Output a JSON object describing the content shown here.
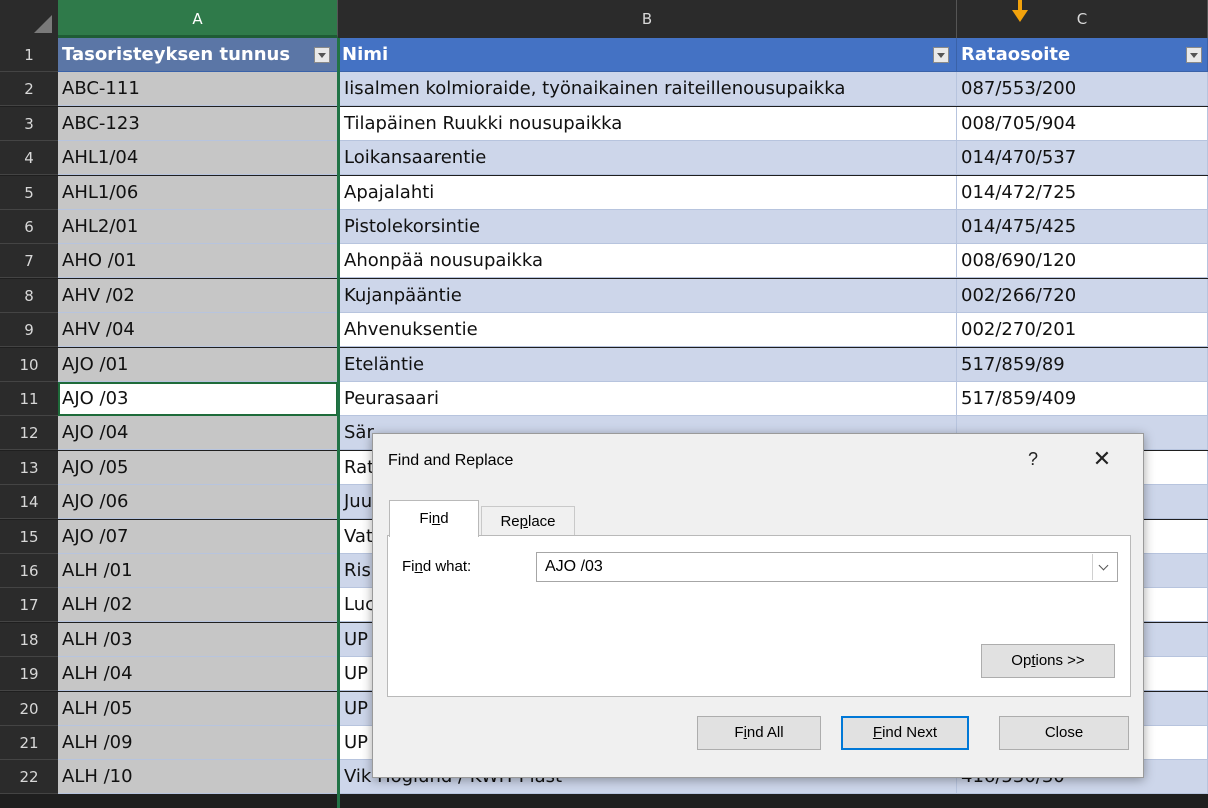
{
  "columns": [
    "A",
    "B",
    "C"
  ],
  "header_row": {
    "num": "1",
    "a": "Tasoristeyksen tunnus",
    "b": "Nimi",
    "c": "Rataosoite"
  },
  "rows": [
    {
      "num": "2",
      "a": "ABC-111",
      "b": "Iisalmen kolmioraide, työnaikainen raiteillenousupaikka",
      "c": "087/553/200"
    },
    {
      "num": "3",
      "a": "ABC-123",
      "b": "Tilapäinen Ruukki nousupaikka",
      "c": "008/705/904"
    },
    {
      "num": "4",
      "a": "AHL1/04",
      "b": "Loikansaarentie",
      "c": "014/470/537"
    },
    {
      "num": "5",
      "a": "AHL1/06",
      "b": "Apajalahti",
      "c": "014/472/725"
    },
    {
      "num": "6",
      "a": "AHL2/01",
      "b": "Pistolekorsintie",
      "c": "014/475/425"
    },
    {
      "num": "7",
      "a": "AHO /01",
      "b": "Ahonpää nousupaikka",
      "c": "008/690/120"
    },
    {
      "num": "8",
      "a": "AHV /02",
      "b": "Kujanpääntie",
      "c": "002/266/720"
    },
    {
      "num": "9",
      "a": "AHV /04",
      "b": "Ahvenuksentie",
      "c": "002/270/201"
    },
    {
      "num": "10",
      "a": "AJO /01",
      "b": "Eteläntie",
      "c": "517/859/89"
    },
    {
      "num": "11",
      "a": "AJO /03",
      "b": "Peurasaari",
      "c": "517/859/409"
    },
    {
      "num": "12",
      "a": "AJO /04",
      "b": "Sär",
      "c": ""
    },
    {
      "num": "13",
      "a": "AJO /05",
      "b": "Rat",
      "c": ""
    },
    {
      "num": "14",
      "a": "AJO /06",
      "b": "Juu",
      "c": ""
    },
    {
      "num": "15",
      "a": "AJO /07",
      "b": "Vat",
      "c": ""
    },
    {
      "num": "16",
      "a": "ALH /01",
      "b": "Ris",
      "c": ""
    },
    {
      "num": "17",
      "a": "ALH /02",
      "b": "Luc",
      "c": ""
    },
    {
      "num": "18",
      "a": "ALH /03",
      "b": "UP",
      "c": ""
    },
    {
      "num": "19",
      "a": "ALH /04",
      "b": "UP",
      "c": ""
    },
    {
      "num": "20",
      "a": "ALH /05",
      "b": "UP",
      "c": ""
    },
    {
      "num": "21",
      "a": "ALH /09",
      "b": "UP",
      "c": ""
    },
    {
      "num": "22",
      "a": "ALH /10",
      "b": "Vik Höglund / KWH-Plast",
      "c": "416/530/30"
    }
  ],
  "dialog": {
    "title": "Find and Replace",
    "help": "?",
    "close_glyph": "✕",
    "tab_find": [
      "Fi",
      "n",
      "d"
    ],
    "tab_replace": [
      "Re",
      "p",
      "lace"
    ],
    "find_what_label": [
      "Fi",
      "n",
      "d what:"
    ],
    "find_what_value": "AJO /03",
    "options_label": [
      "Op",
      "t",
      "ions >>"
    ],
    "find_all_label": [
      "F",
      "i",
      "nd All"
    ],
    "find_next_label": [
      "",
      "F",
      "ind Next"
    ],
    "close_label": "Close"
  },
  "colors": {
    "header_blue": "#4472c4",
    "band_blue": "#cdd6ea",
    "selection_green": "#217346",
    "arrow_orange": "#f2a20c"
  }
}
